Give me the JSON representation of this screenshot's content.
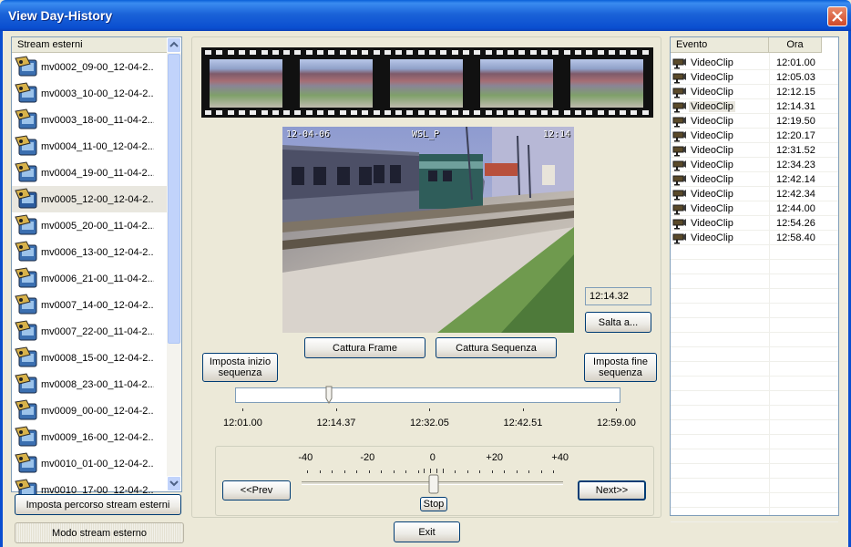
{
  "window": {
    "title": "View Day-History"
  },
  "streams": {
    "header": "Stream esterni",
    "items": [
      {
        "label": "mv0002_09-00_12-04-2..."
      },
      {
        "label": "mv0003_10-00_12-04-2..."
      },
      {
        "label": "mv0003_18-00_11-04-2..."
      },
      {
        "label": "mv0004_11-00_12-04-2..."
      },
      {
        "label": "mv0004_19-00_11-04-2..."
      },
      {
        "label": "mv0005_12-00_12-04-2..."
      },
      {
        "label": "mv0005_20-00_11-04-2..."
      },
      {
        "label": "mv0006_13-00_12-04-2..."
      },
      {
        "label": "mv0006_21-00_11-04-2..."
      },
      {
        "label": "mv0007_14-00_12-04-2..."
      },
      {
        "label": "mv0007_22-00_11-04-2..."
      },
      {
        "label": "mv0008_15-00_12-04-2..."
      },
      {
        "label": "mv0008_23-00_11-04-2..."
      },
      {
        "label": "mv0009_00-00_12-04-2..."
      },
      {
        "label": "mv0009_16-00_12-04-2..."
      },
      {
        "label": "mv0010_01-00_12-04-2..."
      },
      {
        "label": "mv0010_17-00_12-04-2..."
      }
    ],
    "selected_index": 5,
    "set_path_button": "Imposta percorso stream esterni",
    "mode_button": "Modo stream esterno"
  },
  "video": {
    "osd_date": "12-04-06",
    "osd_name": "WSL_P",
    "osd_time": "12:14",
    "capture_frame_button": "Cattura Frame",
    "capture_sequence_button": "Cattura Sequenza",
    "current_time": "12:14.32",
    "jump_button": "Salta a..."
  },
  "timeline": {
    "set_start_button": "Imposta inizio sequenza",
    "set_end_button": "Imposta fine sequenza",
    "position_fraction": 0.243,
    "labels": [
      "12:01.00",
      "12:14.37",
      "12:32.05",
      "12:42.51",
      "12:59.00"
    ]
  },
  "speed": {
    "labels": [
      "-40",
      "-20",
      "0",
      "+20",
      "+40"
    ],
    "prev_button": "<<Prev",
    "next_button": "Next>>",
    "stop_label": "Stop"
  },
  "exit_button": "Exit",
  "events": {
    "col_event": "Evento",
    "col_time": "Ora",
    "selected_index": 3,
    "rows": [
      {
        "type": "VideoClip",
        "time": "12:01.00"
      },
      {
        "type": "VideoClip",
        "time": "12:05.03"
      },
      {
        "type": "VideoClip",
        "time": "12:12.15"
      },
      {
        "type": "VideoClip",
        "time": "12:14.31"
      },
      {
        "type": "VideoClip",
        "time": "12:19.50"
      },
      {
        "type": "VideoClip",
        "time": "12:20.17"
      },
      {
        "type": "VideoClip",
        "time": "12:31.52"
      },
      {
        "type": "VideoClip",
        "time": "12:34.23"
      },
      {
        "type": "VideoClip",
        "time": "12:42.14"
      },
      {
        "type": "VideoClip",
        "time": "12:42.34"
      },
      {
        "type": "VideoClip",
        "time": "12:44.00"
      },
      {
        "type": "VideoClip",
        "time": "12:54.26"
      },
      {
        "type": "VideoClip",
        "time": "12:58.40"
      }
    ]
  },
  "colors": {
    "titlebar": "#0A4ED0",
    "close": "#D1492A",
    "window_bg": "#ECE9D8"
  },
  "icons": {
    "stream": "camera-icon",
    "event": "video-clip-icon",
    "close": "close-icon"
  }
}
